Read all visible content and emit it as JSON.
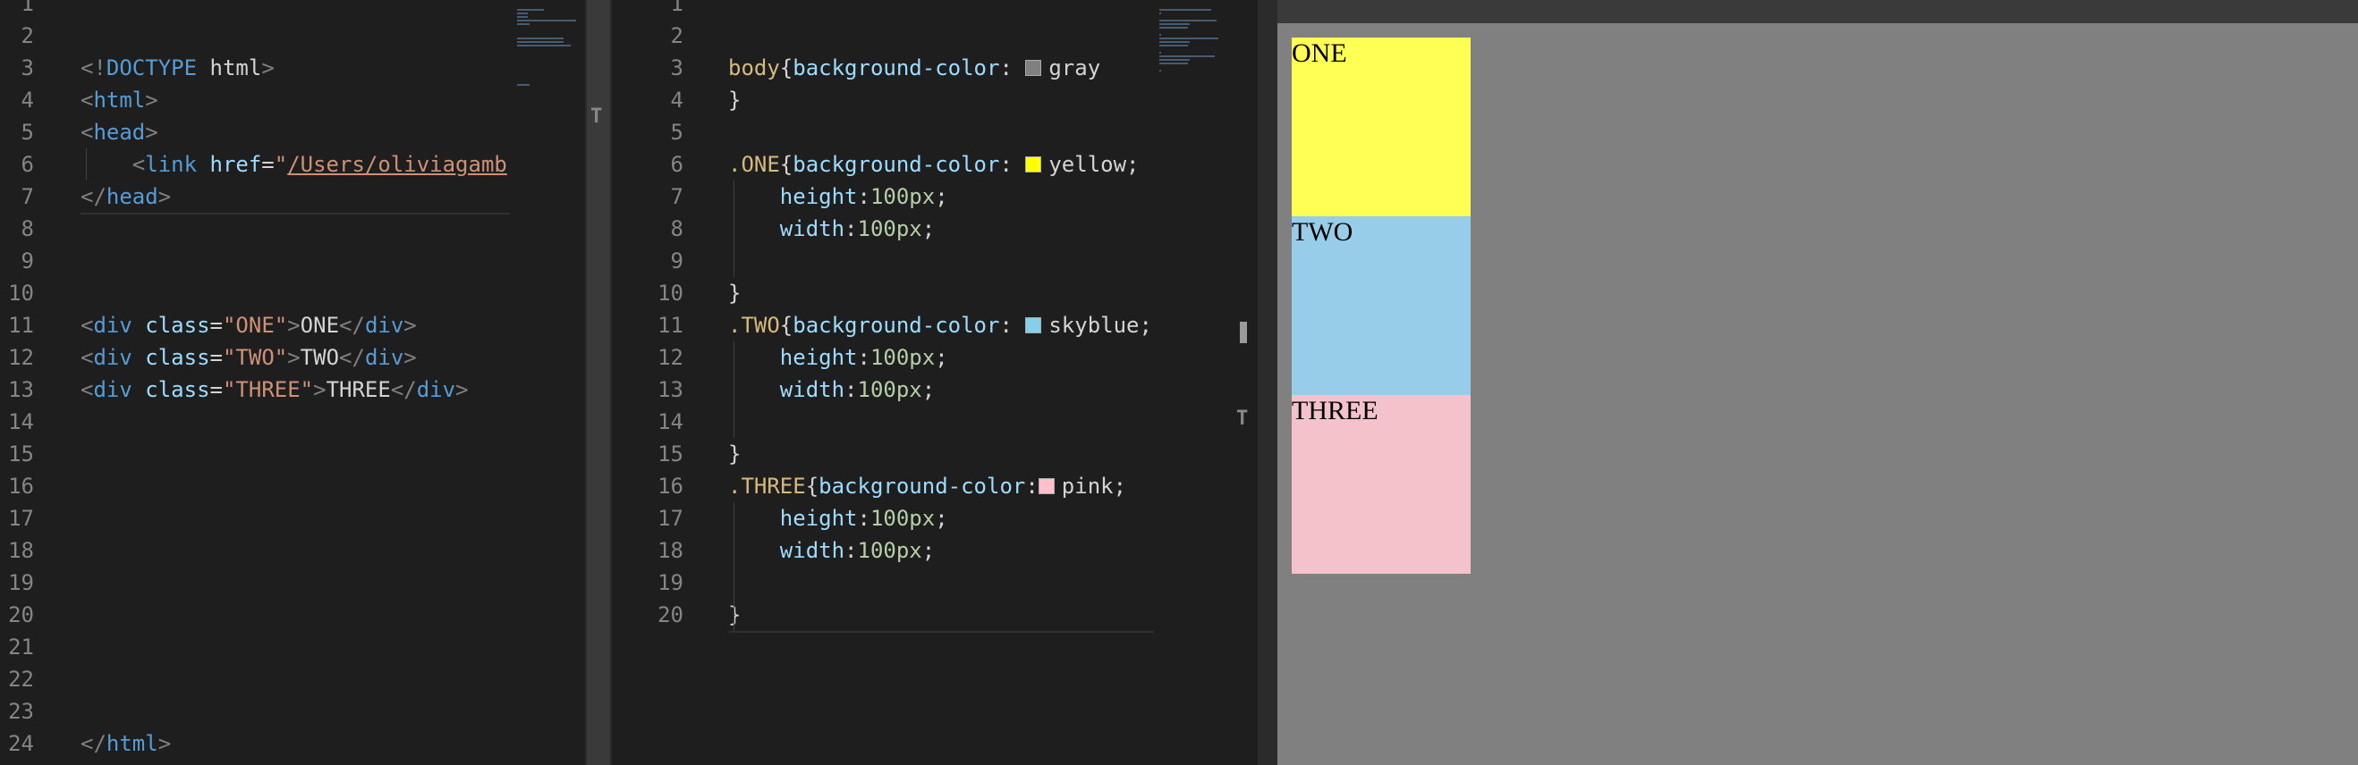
{
  "html_editor": {
    "lines": [
      {
        "n": "1",
        "parts": []
      },
      {
        "n": "2",
        "parts": []
      },
      {
        "n": "3",
        "parts": [
          [
            "punc",
            "<!"
          ],
          [
            "tag",
            "DOCTYPE"
          ],
          [
            "txt",
            " html"
          ],
          [
            "punc",
            ">"
          ]
        ]
      },
      {
        "n": "4",
        "parts": [
          [
            "punc",
            "<"
          ],
          [
            "tag",
            "html"
          ],
          [
            "punc",
            ">"
          ]
        ]
      },
      {
        "n": "5",
        "parts": [
          [
            "punc",
            "<"
          ],
          [
            "tag",
            "head"
          ],
          [
            "punc",
            ">"
          ]
        ]
      },
      {
        "n": "6",
        "parts": [
          [
            "txt",
            "    "
          ],
          [
            "punc",
            "<"
          ],
          [
            "tag",
            "link"
          ],
          [
            "txt",
            " "
          ],
          [
            "attr",
            "href"
          ],
          [
            "txt",
            "="
          ],
          [
            "str",
            "\""
          ],
          [
            "link-str",
            "/Users/oliviagamb"
          ]
        ]
      },
      {
        "n": "7",
        "parts": [
          [
            "punc",
            "</"
          ],
          [
            "tag",
            "head"
          ],
          [
            "punc",
            ">"
          ]
        ]
      },
      {
        "n": "8",
        "parts": []
      },
      {
        "n": "9",
        "parts": []
      },
      {
        "n": "10",
        "parts": []
      },
      {
        "n": "11",
        "parts": [
          [
            "punc",
            "<"
          ],
          [
            "tag",
            "div"
          ],
          [
            "txt",
            " "
          ],
          [
            "attr",
            "class"
          ],
          [
            "txt",
            "="
          ],
          [
            "str",
            "\"ONE\""
          ],
          [
            "punc",
            ">"
          ],
          [
            "txt",
            "ONE"
          ],
          [
            "punc",
            "</"
          ],
          [
            "tag",
            "div"
          ],
          [
            "punc",
            ">"
          ]
        ]
      },
      {
        "n": "12",
        "parts": [
          [
            "punc",
            "<"
          ],
          [
            "tag",
            "div"
          ],
          [
            "txt",
            " "
          ],
          [
            "attr",
            "class"
          ],
          [
            "txt",
            "="
          ],
          [
            "str",
            "\"TWO\""
          ],
          [
            "punc",
            ">"
          ],
          [
            "txt",
            "TWO"
          ],
          [
            "punc",
            "</"
          ],
          [
            "tag",
            "div"
          ],
          [
            "punc",
            ">"
          ]
        ]
      },
      {
        "n": "13",
        "parts": [
          [
            "punc",
            "<"
          ],
          [
            "tag",
            "div"
          ],
          [
            "txt",
            " "
          ],
          [
            "attr",
            "class"
          ],
          [
            "txt",
            "="
          ],
          [
            "str",
            "\"THREE\""
          ],
          [
            "punc",
            ">"
          ],
          [
            "txt",
            "THREE"
          ],
          [
            "punc",
            "</"
          ],
          [
            "tag",
            "div"
          ],
          [
            "punc",
            ">"
          ]
        ]
      },
      {
        "n": "14",
        "parts": []
      },
      {
        "n": "15",
        "parts": []
      },
      {
        "n": "16",
        "parts": []
      },
      {
        "n": "17",
        "parts": []
      },
      {
        "n": "18",
        "parts": []
      },
      {
        "n": "19",
        "parts": []
      },
      {
        "n": "20",
        "parts": []
      },
      {
        "n": "21",
        "parts": []
      },
      {
        "n": "22",
        "parts": []
      },
      {
        "n": "23",
        "parts": []
      },
      {
        "n": "24",
        "parts": [
          [
            "punc",
            "</"
          ],
          [
            "tag",
            "html"
          ],
          [
            "punc",
            ">"
          ]
        ]
      }
    ]
  },
  "css_editor": {
    "lines": [
      {
        "n": "1",
        "parts": []
      },
      {
        "n": "2",
        "parts": []
      },
      {
        "n": "3",
        "parts": [
          [
            "sel",
            "body"
          ],
          [
            "val",
            "{"
          ],
          [
            "prop",
            "background-color"
          ],
          [
            "val",
            ": "
          ],
          [
            "swatch",
            "#808080"
          ],
          [
            "val",
            "gray"
          ]
        ]
      },
      {
        "n": "4",
        "parts": [
          [
            "val",
            "}"
          ]
        ]
      },
      {
        "n": "5",
        "parts": []
      },
      {
        "n": "6",
        "parts": [
          [
            "sel",
            ".ONE"
          ],
          [
            "val",
            "{"
          ],
          [
            "prop",
            "background-color"
          ],
          [
            "val",
            ": "
          ],
          [
            "swatch",
            "#ffff00"
          ],
          [
            "val",
            "yellow;"
          ]
        ]
      },
      {
        "n": "7",
        "parts": [
          [
            "val",
            "    "
          ],
          [
            "prop",
            "height"
          ],
          [
            "val",
            ":"
          ],
          [
            "num",
            "100px"
          ],
          [
            "val",
            ";"
          ]
        ]
      },
      {
        "n": "8",
        "parts": [
          [
            "val",
            "    "
          ],
          [
            "prop",
            "width"
          ],
          [
            "val",
            ":"
          ],
          [
            "num",
            "100px"
          ],
          [
            "val",
            ";"
          ]
        ]
      },
      {
        "n": "9",
        "parts": []
      },
      {
        "n": "10",
        "parts": [
          [
            "val",
            "}"
          ]
        ]
      },
      {
        "n": "11",
        "parts": [
          [
            "sel",
            ".TWO"
          ],
          [
            "val",
            "{"
          ],
          [
            "prop",
            "background-color"
          ],
          [
            "val",
            ": "
          ],
          [
            "swatch",
            "#87ceeb"
          ],
          [
            "val",
            "skyblue;"
          ]
        ]
      },
      {
        "n": "12",
        "parts": [
          [
            "val",
            "    "
          ],
          [
            "prop",
            "height"
          ],
          [
            "val",
            ":"
          ],
          [
            "num",
            "100px"
          ],
          [
            "val",
            ";"
          ]
        ]
      },
      {
        "n": "13",
        "parts": [
          [
            "val",
            "    "
          ],
          [
            "prop",
            "width"
          ],
          [
            "val",
            ":"
          ],
          [
            "num",
            "100px"
          ],
          [
            "val",
            ";"
          ]
        ]
      },
      {
        "n": "14",
        "parts": []
      },
      {
        "n": "15",
        "parts": [
          [
            "val",
            "}"
          ]
        ]
      },
      {
        "n": "16",
        "parts": [
          [
            "sel",
            ".THREE"
          ],
          [
            "val",
            "{"
          ],
          [
            "prop",
            "background-color"
          ],
          [
            "val",
            ":"
          ],
          [
            "swatch",
            "#ffc0cb"
          ],
          [
            "val",
            "pink;"
          ]
        ]
      },
      {
        "n": "17",
        "parts": [
          [
            "val",
            "    "
          ],
          [
            "prop",
            "height"
          ],
          [
            "val",
            ":"
          ],
          [
            "num",
            "100px"
          ],
          [
            "val",
            ";"
          ]
        ]
      },
      {
        "n": "18",
        "parts": [
          [
            "val",
            "    "
          ],
          [
            "prop",
            "width"
          ],
          [
            "val",
            ":"
          ],
          [
            "num",
            "100px"
          ],
          [
            "val",
            ";"
          ]
        ]
      },
      {
        "n": "19",
        "parts": []
      },
      {
        "n": "20",
        "parts": [
          [
            "val",
            "}"
          ]
        ]
      }
    ]
  },
  "preview": {
    "background": "#808080",
    "boxes": [
      {
        "label": "ONE",
        "color": "#ffff54"
      },
      {
        "label": "TWO",
        "color": "#97cde9"
      },
      {
        "label": "THREE",
        "color": "#f3c2cb"
      }
    ]
  }
}
